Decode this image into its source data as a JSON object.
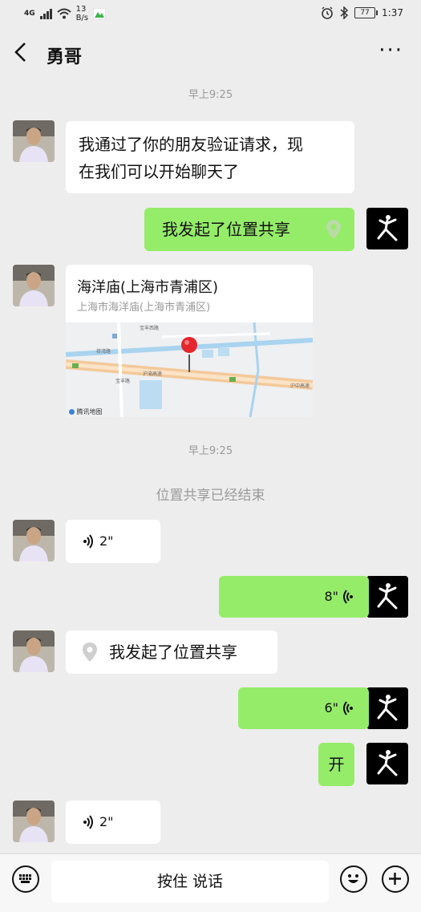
{
  "status": {
    "network": "4G",
    "speed_value": "13",
    "speed_unit": "B/s",
    "battery": "77",
    "clock": "1:37"
  },
  "header": {
    "back": "<",
    "title": "勇哥",
    "more": "···"
  },
  "messages": {
    "time1": "早上9:25",
    "m1": {
      "line1": "我通过了你的朋友验证请求，现",
      "line2": "在我们可以开始聊天了"
    },
    "m2": "我发起了位置共享",
    "map": {
      "title": "海洋庙(上海市青浦区)",
      "subtitle": "上海市海洋庙(上海市青浦区)",
      "watermark": "腾讯地图",
      "label_a": "宝丰西路",
      "label_b": "荷湾路",
      "label_c": "沪渝高速",
      "label_d": "宝丰路",
      "label_e": "沪中高速"
    },
    "time2": "早上9:25",
    "sys1": "位置共享已经结束",
    "v1": "2\"",
    "v2": "8\"",
    "m3": "我发起了位置共享",
    "v3": "6\"",
    "m4": "开",
    "v4": "2\""
  },
  "footer": {
    "hold_to_talk": "按住 说话"
  }
}
